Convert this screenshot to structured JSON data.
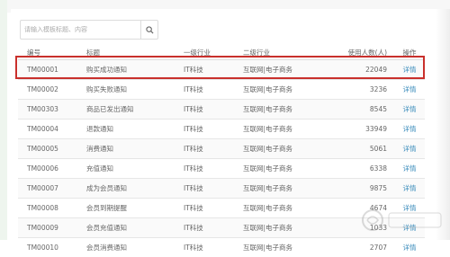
{
  "top": {
    "title": ""
  },
  "search": {
    "placeholder": "请输入模板标题、内容",
    "icon": "search-icon"
  },
  "table": {
    "headers": [
      "编号",
      "标题",
      "一级行业",
      "二级行业",
      "使用人数(人)",
      "操作"
    ],
    "rows": [
      {
        "id": "TM00001",
        "title": "购买成功通知",
        "industry1": "IT科技",
        "industry2": "互联网|电子商务",
        "users": "22049",
        "action": "详情"
      },
      {
        "id": "TM00002",
        "title": "购买失败通知",
        "industry1": "IT科技",
        "industry2": "互联网|电子商务",
        "users": "3236",
        "action": "详情"
      },
      {
        "id": "TM00303",
        "title": "商品已发出通知",
        "industry1": "IT科技",
        "industry2": "互联网|电子商务",
        "users": "8545",
        "action": "详情"
      },
      {
        "id": "TM00004",
        "title": "退款通知",
        "industry1": "IT科技",
        "industry2": "互联网|电子商务",
        "users": "33949",
        "action": "详情"
      },
      {
        "id": "TM00005",
        "title": "消费通知",
        "industry1": "IT科技",
        "industry2": "互联网|电子商务",
        "users": "5061",
        "action": "详情"
      },
      {
        "id": "TM00006",
        "title": "充值通知",
        "industry1": "IT科技",
        "industry2": "互联网|电子商务",
        "users": "6338",
        "action": "详情"
      },
      {
        "id": "TM00007",
        "title": "成为会员通知",
        "industry1": "IT科技",
        "industry2": "互联网|电子商务",
        "users": "9875",
        "action": "详情"
      },
      {
        "id": "TM00008",
        "title": "会员到期提醒",
        "industry1": "IT科技",
        "industry2": "互联网|电子商务",
        "users": "4674",
        "action": "详情"
      },
      {
        "id": "TM00009",
        "title": "会员充值通知",
        "industry1": "IT科技",
        "industry2": "互联网|电子商务",
        "users": "1033",
        "action": "详情"
      },
      {
        "id": "TM00010",
        "title": "会员消费通知",
        "industry1": "IT科技",
        "industry2": "互联网|电子商务",
        "users": "2707",
        "action": "详情"
      }
    ]
  },
  "colors": {
    "highlight": "#c9302c",
    "link": "#3c8dbc"
  }
}
